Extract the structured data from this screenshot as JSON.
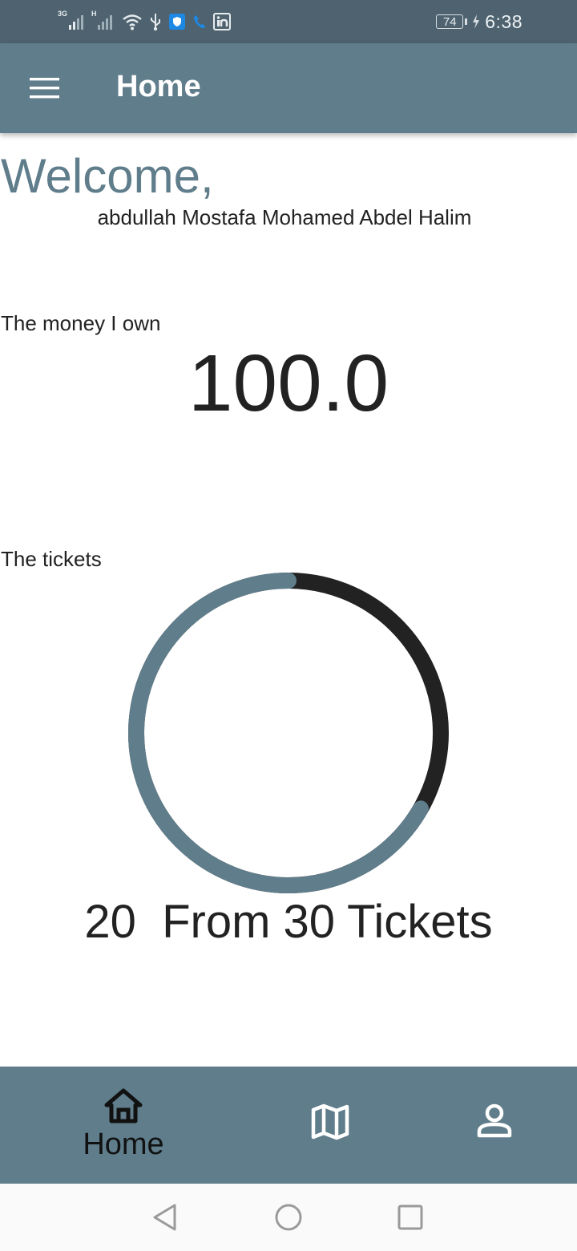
{
  "status_bar": {
    "network_1": "3G",
    "network_2": "H",
    "battery": "74",
    "time": "6:38",
    "icons": [
      "signal-3g-icon",
      "signal-h-icon",
      "wifi-icon",
      "usb-icon",
      "shield-icon",
      "phone-icon",
      "linkedin-icon",
      "battery-icon",
      "charging-icon"
    ]
  },
  "app_bar": {
    "title": "Home",
    "menu_icon": "hamburger-menu-icon"
  },
  "welcome": {
    "title": "Welcome,",
    "user_name": "abdullah Mostafa Mohamed Abdel Halim"
  },
  "money": {
    "label": "The money I own",
    "value": "100.0"
  },
  "tickets": {
    "label": "The tickets",
    "used": 20,
    "total": 30,
    "summary": "20  From 30 Tickets",
    "progress_fraction": 0.667
  },
  "bottom_nav": {
    "items": [
      {
        "label": "Home",
        "icon": "home-icon",
        "active": true
      },
      {
        "label": "",
        "icon": "map-icon",
        "active": false
      },
      {
        "label": "",
        "icon": "person-icon",
        "active": false
      }
    ]
  },
  "system_nav": {
    "icons": [
      "back-icon",
      "home-circle-icon",
      "recents-icon"
    ]
  },
  "colors": {
    "primary": "#607d8b",
    "status_bar": "#4e636f",
    "ring_remaining": "#222222",
    "text": "#222222"
  }
}
